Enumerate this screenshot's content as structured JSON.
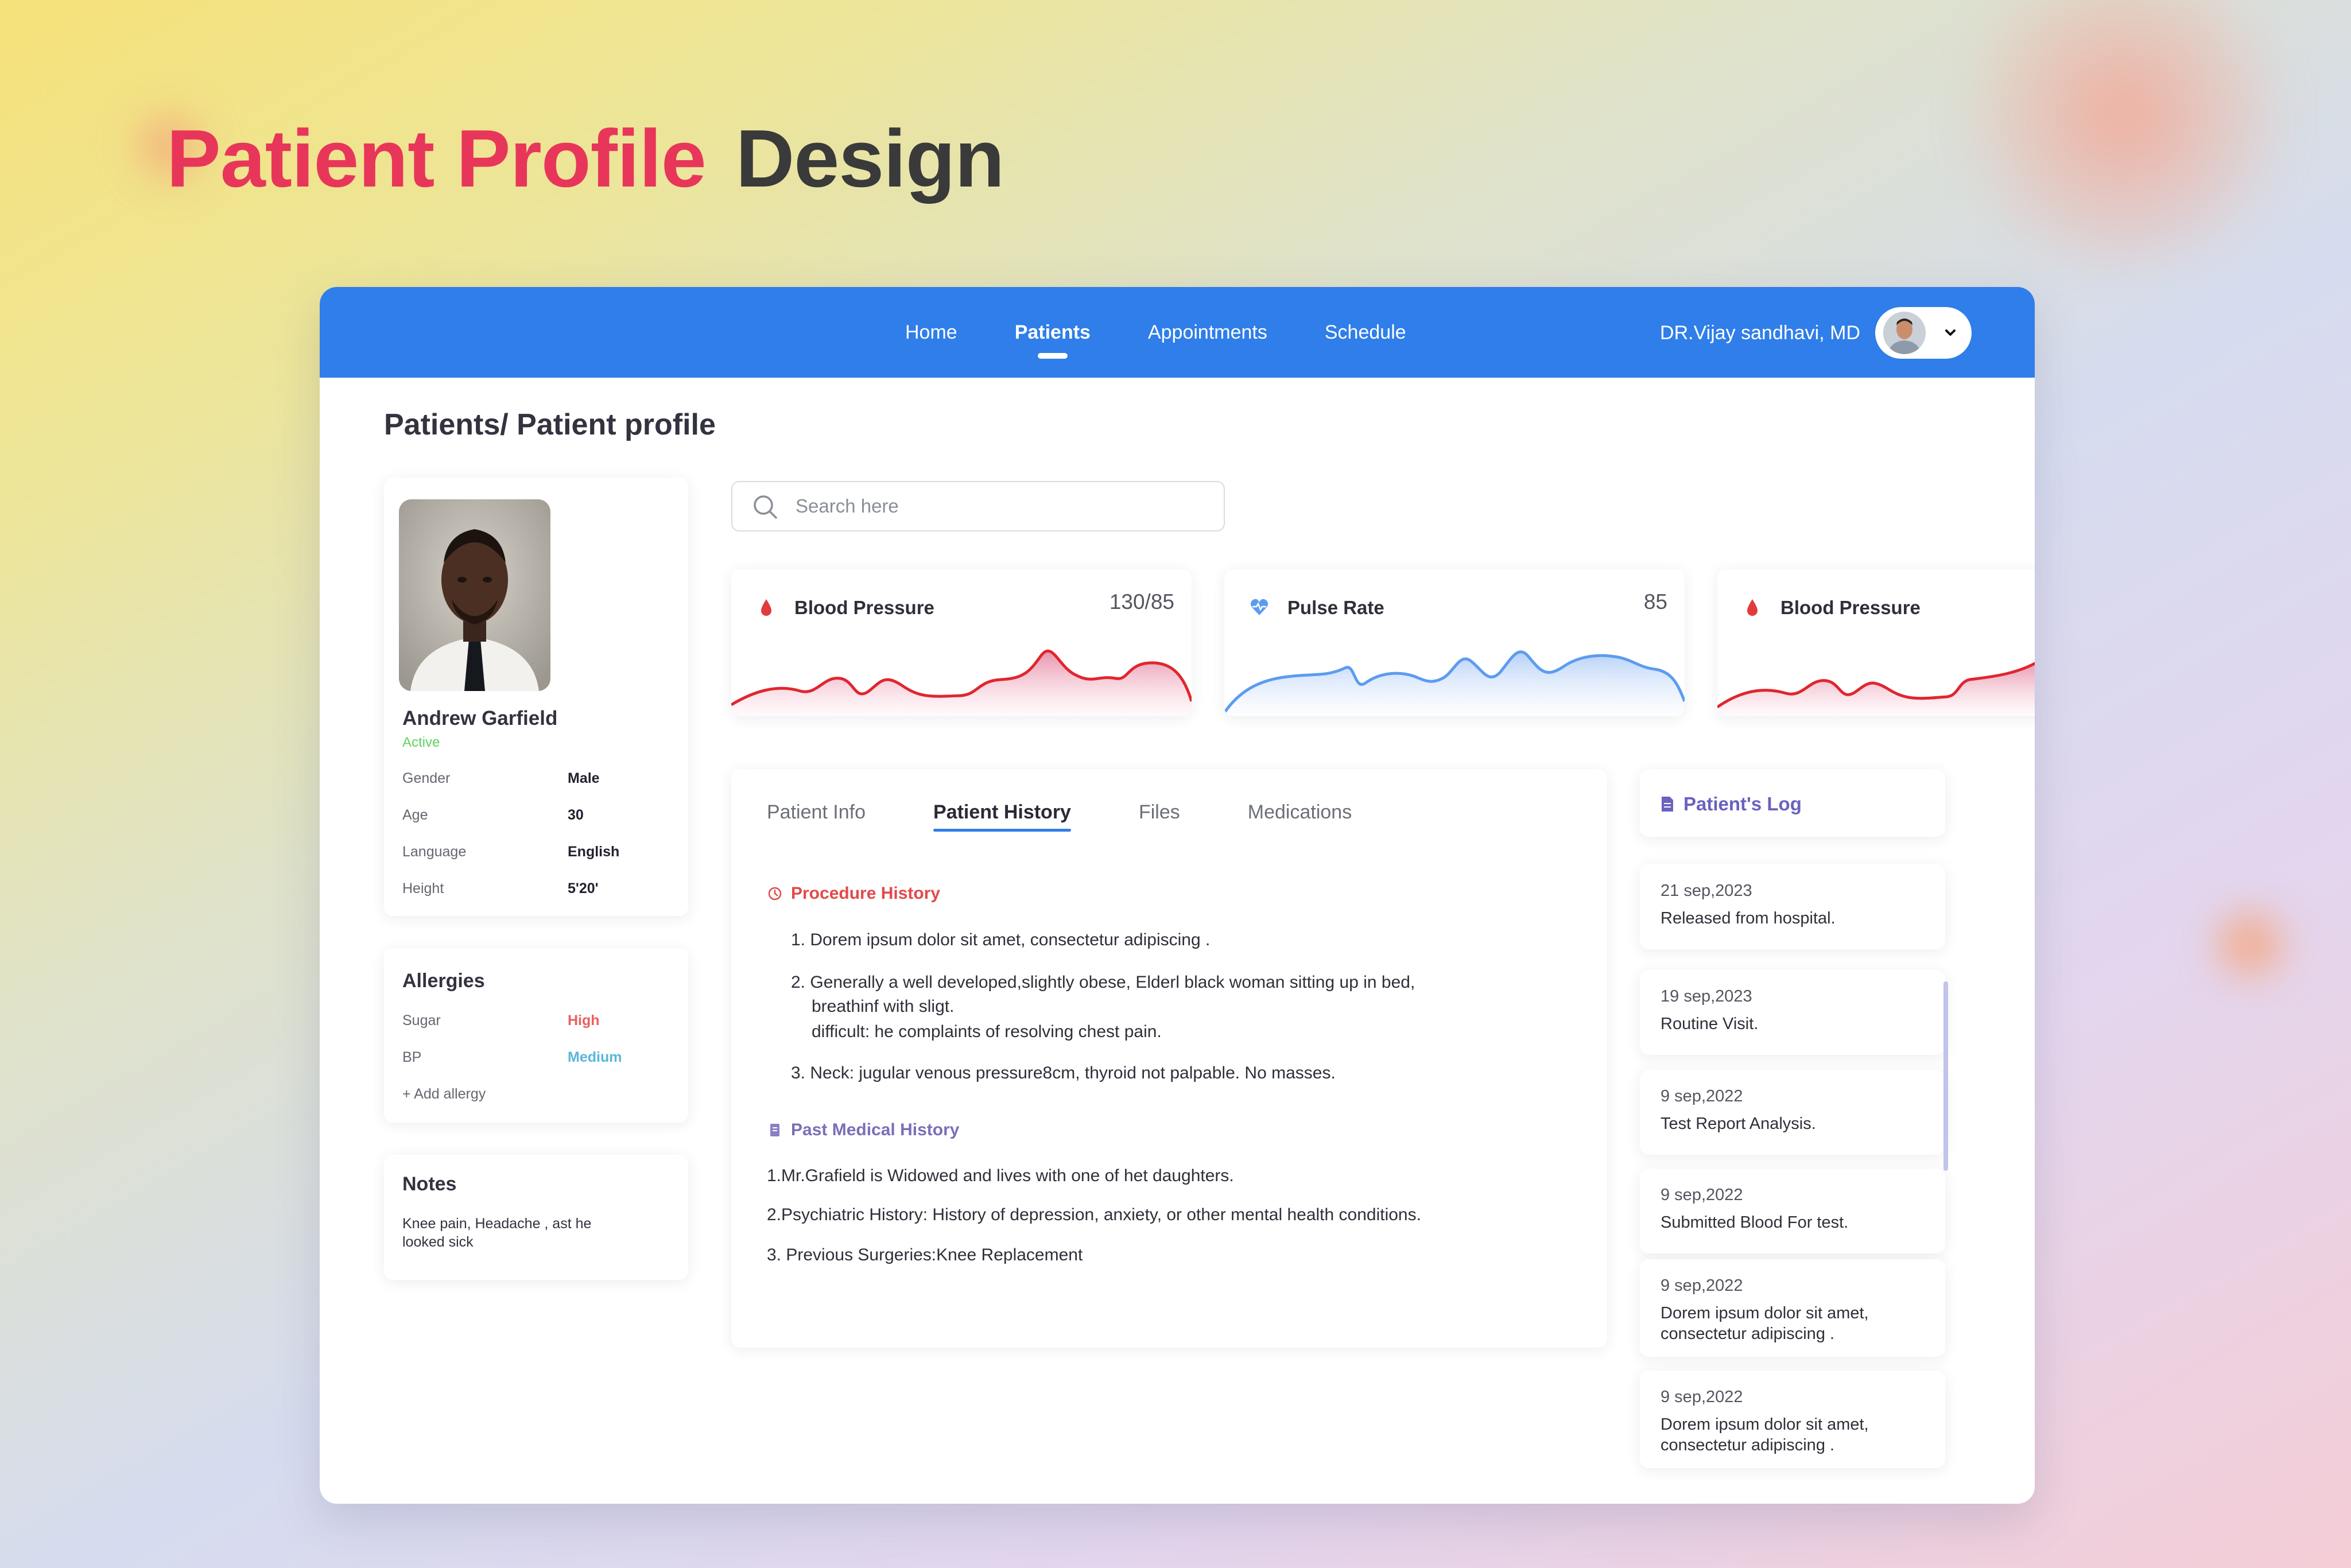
{
  "hero": {
    "title_accent": "Patient Profile",
    "title_rest": "Design"
  },
  "nav": {
    "items": [
      {
        "label": "Home",
        "active": false
      },
      {
        "label": "Patients",
        "active": true
      },
      {
        "label": "Appointments",
        "active": false
      },
      {
        "label": "Schedule",
        "active": false
      }
    ],
    "doctor_name": "DR.Vijay sandhavi, MD"
  },
  "breadcrumb": "Patients/ Patient profile",
  "search": {
    "placeholder": "Search here"
  },
  "profile": {
    "name": "Andrew Garfield",
    "status": "Active",
    "fields": [
      {
        "label": "Gender",
        "value": "Male"
      },
      {
        "label": "Age",
        "value": "30"
      },
      {
        "label": "Language",
        "value": "English"
      },
      {
        "label": "Height",
        "value": "5'20'"
      }
    ]
  },
  "allergies": {
    "title": "Allergies",
    "items": [
      {
        "label": "Sugar",
        "level": "High",
        "color": "#e8605f"
      },
      {
        "label": "BP",
        "level": "Medium",
        "color": "#5bb7d9"
      }
    ],
    "add_label": "+   Add allergy"
  },
  "notes": {
    "title": "Notes",
    "text": "Knee pain, Headache , ast he looked sick"
  },
  "vitals": [
    {
      "title": "Blood Pressure",
      "value": "130/85",
      "icon": "blood-drop-icon",
      "color": "#e23b3b"
    },
    {
      "title": "Pulse Rate",
      "value": "85",
      "icon": "heart-pulse-icon",
      "color": "#5b9cf0"
    },
    {
      "title": "Blood Pressure",
      "value": "",
      "icon": "blood-drop-icon",
      "color": "#e23b3b"
    }
  ],
  "tabs": [
    {
      "label": "Patient Info",
      "active": false
    },
    {
      "label": "Patient History",
      "active": true
    },
    {
      "label": "Files",
      "active": false
    },
    {
      "label": "Medications",
      "active": false
    }
  ],
  "history": {
    "procedure_title": "Procedure History",
    "procedure_items": [
      "1. Dorem ipsum dolor sit amet, consectetur adipiscing .",
      "2. Generally a well developed,slightly obese, Elderl black woman sitting up in bed,",
      "breathinf with sligt.",
      "difficult: he complaints of resolving chest pain.",
      "3. Neck: jugular venous pressure8cm, thyroid not palpable. No masses."
    ],
    "past_title": "Past Medical History",
    "past_items": [
      "1.Mr.Grafield is Widowed and lives with one of het daughters.",
      "2.Psychiatric History: History of depression, anxiety, or other mental health conditions.",
      "3. Previous Surgeries:Knee Replacement"
    ]
  },
  "log": {
    "title": "Patient's Log",
    "entries": [
      {
        "date": "21 sep,2023",
        "text": "Released from hospital."
      },
      {
        "date": "19 sep,2023",
        "text": "Routine Visit."
      },
      {
        "date": "9 sep,2022",
        "text": "Test Report Analysis."
      },
      {
        "date": "9 sep,2022",
        "text": "Submitted Blood For test."
      },
      {
        "date": "9 sep,2022",
        "text": "Dorem ipsum dolor sit amet, consectetur adipiscing ."
      },
      {
        "date": "9 sep,2022",
        "text": "Dorem ipsum dolor sit amet, consectetur adipiscing ."
      }
    ]
  }
}
